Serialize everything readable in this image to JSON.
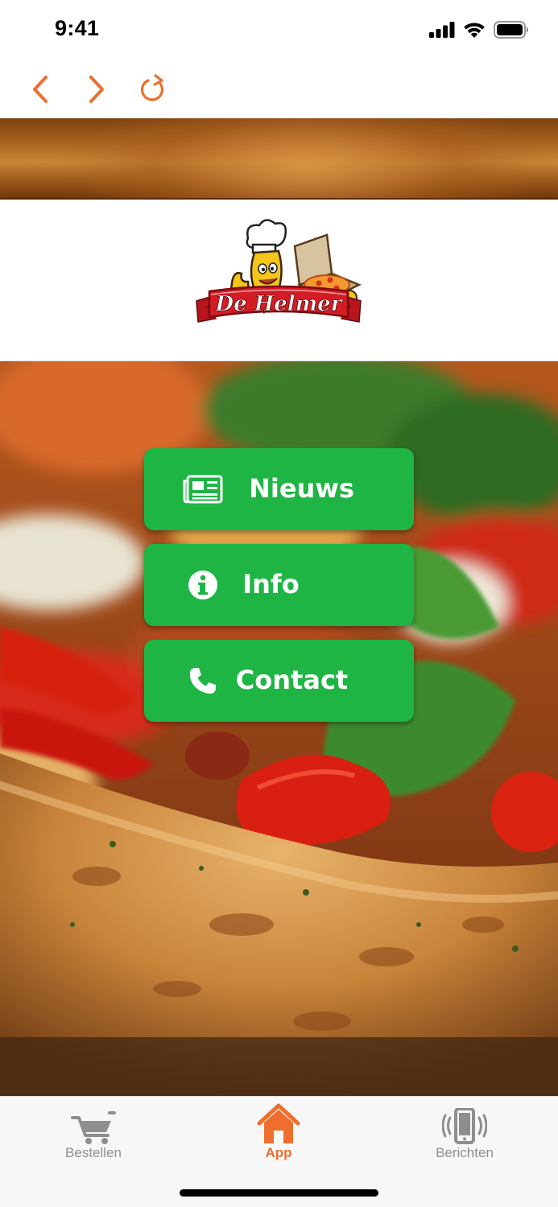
{
  "status_bar": {
    "time": "9:41"
  },
  "nav": {
    "back_icon": "chevron-left-icon",
    "forward_icon": "chevron-right-icon",
    "reload_icon": "reload-icon",
    "accent": "#ee6f2d"
  },
  "logo": {
    "text": "De Helmer"
  },
  "menu": {
    "items": [
      {
        "label": "Nieuws",
        "icon": "newspaper-icon"
      },
      {
        "label": "Info",
        "icon": "info-icon"
      },
      {
        "label": "Contact",
        "icon": "phone-icon"
      }
    ],
    "button_color": "#1fb545"
  },
  "tabs": {
    "items": [
      {
        "label": "Bestellen",
        "icon": "cart-icon",
        "active": false
      },
      {
        "label": "App",
        "icon": "home-icon",
        "active": true
      },
      {
        "label": "Berichten",
        "icon": "phone-vibrate-icon",
        "active": false
      }
    ],
    "active_color": "#ee6f2d",
    "inactive_color": "#8e8e8e"
  }
}
